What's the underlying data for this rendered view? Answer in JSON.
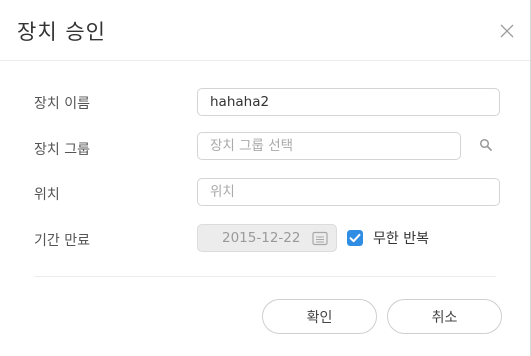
{
  "dialog": {
    "title": "장치 승인",
    "close_icon": "close-icon"
  },
  "form": {
    "name": {
      "label": "장치 이름",
      "value": "hahaha2",
      "placeholder": ""
    },
    "group": {
      "label": "장치 그룹",
      "value": "",
      "placeholder": "장치 그룹 선택",
      "icon": "search-icon"
    },
    "location": {
      "label": "위치",
      "value": "",
      "placeholder": "위치"
    },
    "expiry": {
      "label": "기간 만료",
      "date": "2015-12-22",
      "calendar_icon": "calendar-icon",
      "checkbox_label": "무한 반복",
      "checked": true
    }
  },
  "buttons": {
    "confirm": "확인",
    "cancel": "취소"
  },
  "colors": {
    "accent": "#2f8de4",
    "border": "#d4d4d4",
    "disabled_bg": "#ececec"
  }
}
